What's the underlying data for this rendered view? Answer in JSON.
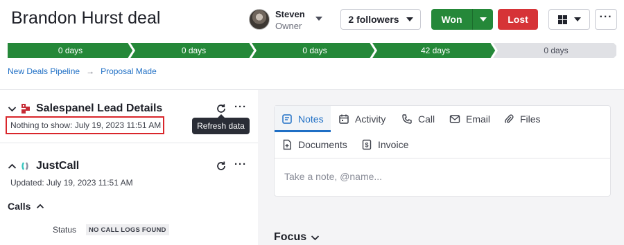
{
  "deal": {
    "title": "Brandon Hurst deal"
  },
  "owner": {
    "name": "Steven",
    "role": "Owner"
  },
  "actions": {
    "followers_label": "2 followers",
    "won_label": "Won",
    "lost_label": "Lost",
    "more_label": "···"
  },
  "pipeline": {
    "stages": [
      {
        "label": "0 days",
        "status": "done"
      },
      {
        "label": "0 days",
        "status": "done"
      },
      {
        "label": "0 days",
        "status": "done"
      },
      {
        "label": "42 days",
        "status": "done"
      },
      {
        "label": "0 days",
        "status": "todo"
      }
    ]
  },
  "breadcrumb": {
    "items": [
      "New Deals Pipeline",
      "Proposal Made"
    ],
    "separator": "→"
  },
  "salespanel": {
    "title": "Salespanel Lead Details",
    "status": "Nothing to show: July 19, 2023 11:51 AM",
    "tooltip": "Refresh data",
    "more": "···"
  },
  "justcall": {
    "title": "JustCall",
    "updated": "Updated: July 19, 2023 11:51 AM",
    "more": "···",
    "calls_title": "Calls",
    "status_label": "Status",
    "status_value": "NO CALL LOGS FOUND"
  },
  "notes_card": {
    "tabs": [
      "Notes",
      "Activity",
      "Call",
      "Email",
      "Files",
      "Documents",
      "Invoice"
    ],
    "active_tab": "Notes",
    "placeholder": "Take a note, @name..."
  },
  "focus": {
    "title": "Focus"
  },
  "colors": {
    "won_green": "#258839",
    "lost_red": "#d63337",
    "link_blue": "#1f6fc5",
    "highlight_red": "#d9262b"
  },
  "icons": {
    "view": "grid-view-icon",
    "refresh": "refresh-icon",
    "salespanel_logo": "salespanel-logo-icon",
    "justcall_logo": "justcall-logo-icon"
  }
}
